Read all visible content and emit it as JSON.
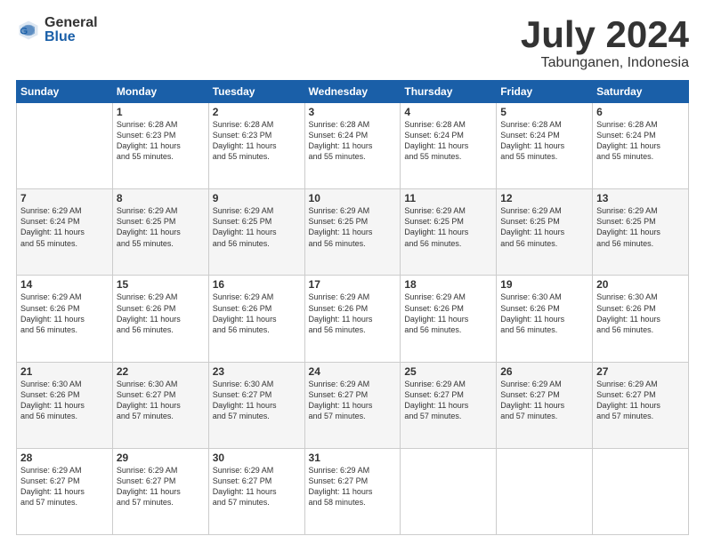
{
  "header": {
    "logo": {
      "general": "General",
      "blue": "Blue"
    },
    "title": "July 2024",
    "subtitle": "Tabunganen, Indonesia"
  },
  "weekdays": [
    "Sunday",
    "Monday",
    "Tuesday",
    "Wednesday",
    "Thursday",
    "Friday",
    "Saturday"
  ],
  "weeks": [
    [
      {
        "day": "",
        "info": ""
      },
      {
        "day": "1",
        "info": "Sunrise: 6:28 AM\nSunset: 6:23 PM\nDaylight: 11 hours\nand 55 minutes."
      },
      {
        "day": "2",
        "info": "Sunrise: 6:28 AM\nSunset: 6:23 PM\nDaylight: 11 hours\nand 55 minutes."
      },
      {
        "day": "3",
        "info": "Sunrise: 6:28 AM\nSunset: 6:24 PM\nDaylight: 11 hours\nand 55 minutes."
      },
      {
        "day": "4",
        "info": "Sunrise: 6:28 AM\nSunset: 6:24 PM\nDaylight: 11 hours\nand 55 minutes."
      },
      {
        "day": "5",
        "info": "Sunrise: 6:28 AM\nSunset: 6:24 PM\nDaylight: 11 hours\nand 55 minutes."
      },
      {
        "day": "6",
        "info": "Sunrise: 6:28 AM\nSunset: 6:24 PM\nDaylight: 11 hours\nand 55 minutes."
      }
    ],
    [
      {
        "day": "7",
        "info": "Sunrise: 6:29 AM\nSunset: 6:24 PM\nDaylight: 11 hours\nand 55 minutes."
      },
      {
        "day": "8",
        "info": "Sunrise: 6:29 AM\nSunset: 6:25 PM\nDaylight: 11 hours\nand 55 minutes."
      },
      {
        "day": "9",
        "info": "Sunrise: 6:29 AM\nSunset: 6:25 PM\nDaylight: 11 hours\nand 56 minutes."
      },
      {
        "day": "10",
        "info": "Sunrise: 6:29 AM\nSunset: 6:25 PM\nDaylight: 11 hours\nand 56 minutes."
      },
      {
        "day": "11",
        "info": "Sunrise: 6:29 AM\nSunset: 6:25 PM\nDaylight: 11 hours\nand 56 minutes."
      },
      {
        "day": "12",
        "info": "Sunrise: 6:29 AM\nSunset: 6:25 PM\nDaylight: 11 hours\nand 56 minutes."
      },
      {
        "day": "13",
        "info": "Sunrise: 6:29 AM\nSunset: 6:25 PM\nDaylight: 11 hours\nand 56 minutes."
      }
    ],
    [
      {
        "day": "14",
        "info": "Sunrise: 6:29 AM\nSunset: 6:26 PM\nDaylight: 11 hours\nand 56 minutes."
      },
      {
        "day": "15",
        "info": "Sunrise: 6:29 AM\nSunset: 6:26 PM\nDaylight: 11 hours\nand 56 minutes."
      },
      {
        "day": "16",
        "info": "Sunrise: 6:29 AM\nSunset: 6:26 PM\nDaylight: 11 hours\nand 56 minutes."
      },
      {
        "day": "17",
        "info": "Sunrise: 6:29 AM\nSunset: 6:26 PM\nDaylight: 11 hours\nand 56 minutes."
      },
      {
        "day": "18",
        "info": "Sunrise: 6:29 AM\nSunset: 6:26 PM\nDaylight: 11 hours\nand 56 minutes."
      },
      {
        "day": "19",
        "info": "Sunrise: 6:30 AM\nSunset: 6:26 PM\nDaylight: 11 hours\nand 56 minutes."
      },
      {
        "day": "20",
        "info": "Sunrise: 6:30 AM\nSunset: 6:26 PM\nDaylight: 11 hours\nand 56 minutes."
      }
    ],
    [
      {
        "day": "21",
        "info": "Sunrise: 6:30 AM\nSunset: 6:26 PM\nDaylight: 11 hours\nand 56 minutes."
      },
      {
        "day": "22",
        "info": "Sunrise: 6:30 AM\nSunset: 6:27 PM\nDaylight: 11 hours\nand 57 minutes."
      },
      {
        "day": "23",
        "info": "Sunrise: 6:30 AM\nSunset: 6:27 PM\nDaylight: 11 hours\nand 57 minutes."
      },
      {
        "day": "24",
        "info": "Sunrise: 6:29 AM\nSunset: 6:27 PM\nDaylight: 11 hours\nand 57 minutes."
      },
      {
        "day": "25",
        "info": "Sunrise: 6:29 AM\nSunset: 6:27 PM\nDaylight: 11 hours\nand 57 minutes."
      },
      {
        "day": "26",
        "info": "Sunrise: 6:29 AM\nSunset: 6:27 PM\nDaylight: 11 hours\nand 57 minutes."
      },
      {
        "day": "27",
        "info": "Sunrise: 6:29 AM\nSunset: 6:27 PM\nDaylight: 11 hours\nand 57 minutes."
      }
    ],
    [
      {
        "day": "28",
        "info": "Sunrise: 6:29 AM\nSunset: 6:27 PM\nDaylight: 11 hours\nand 57 minutes."
      },
      {
        "day": "29",
        "info": "Sunrise: 6:29 AM\nSunset: 6:27 PM\nDaylight: 11 hours\nand 57 minutes."
      },
      {
        "day": "30",
        "info": "Sunrise: 6:29 AM\nSunset: 6:27 PM\nDaylight: 11 hours\nand 57 minutes."
      },
      {
        "day": "31",
        "info": "Sunrise: 6:29 AM\nSunset: 6:27 PM\nDaylight: 11 hours\nand 58 minutes."
      },
      {
        "day": "",
        "info": ""
      },
      {
        "day": "",
        "info": ""
      },
      {
        "day": "",
        "info": ""
      }
    ]
  ]
}
